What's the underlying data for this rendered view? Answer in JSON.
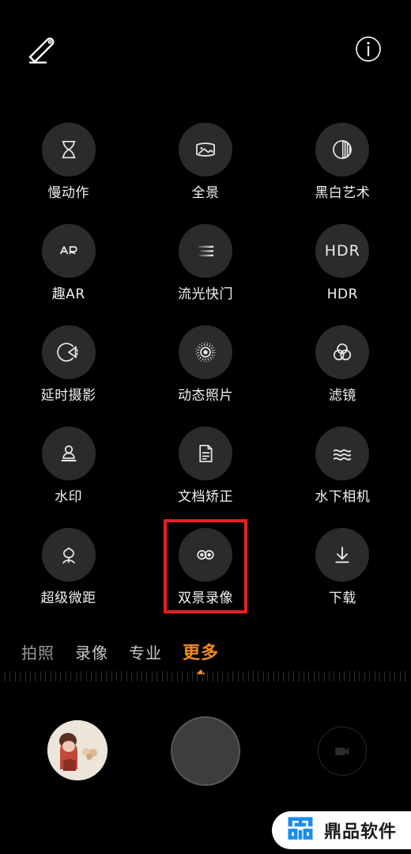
{
  "app": {
    "screen_title": "Camera More Modes",
    "background_color": "#000000",
    "accent_color": "#f08a1e",
    "highlight_color": "#e62020"
  },
  "topbar": {
    "edit_icon": "pencil-edit-icon",
    "info_icon": "info-circle-icon"
  },
  "modes": [
    {
      "label": "慢动作",
      "icon": "hourglass-icon"
    },
    {
      "label": "全景",
      "icon": "panorama-icon"
    },
    {
      "label": "黑白艺术",
      "icon": "monochrome-icon"
    },
    {
      "label": "趣AR",
      "icon": "ar-icon"
    },
    {
      "label": "流光快门",
      "icon": "light-painting-icon"
    },
    {
      "label": "HDR",
      "icon": "hdr-icon"
    },
    {
      "label": "延时摄影",
      "icon": "timelapse-icon"
    },
    {
      "label": "动态照片",
      "icon": "moving-picture-icon"
    },
    {
      "label": "滤镜",
      "icon": "filter-circles-icon"
    },
    {
      "label": "水印",
      "icon": "watermark-stamp-icon"
    },
    {
      "label": "文档矫正",
      "icon": "document-correction-icon"
    },
    {
      "label": "水下相机",
      "icon": "underwater-waves-icon"
    },
    {
      "label": "超级微距",
      "icon": "macro-flower-icon"
    },
    {
      "label": "双景录像",
      "icon": "dual-view-video-icon",
      "highlighted": true
    },
    {
      "label": "下载",
      "icon": "download-arrow-icon"
    }
  ],
  "tabs": [
    {
      "label": "拍照",
      "active": false
    },
    {
      "label": "录像",
      "active": false
    },
    {
      "label": "专业",
      "active": false
    },
    {
      "label": "更多",
      "active": true
    }
  ],
  "bottom": {
    "gallery_thumb": "gallery-thumbnail",
    "shutter": "shutter-button",
    "switch": "video-record-button"
  },
  "watermark": {
    "text": "鼎品软件",
    "logo": "dingpin-logo-icon",
    "logo_color": "#1a8cf0"
  }
}
